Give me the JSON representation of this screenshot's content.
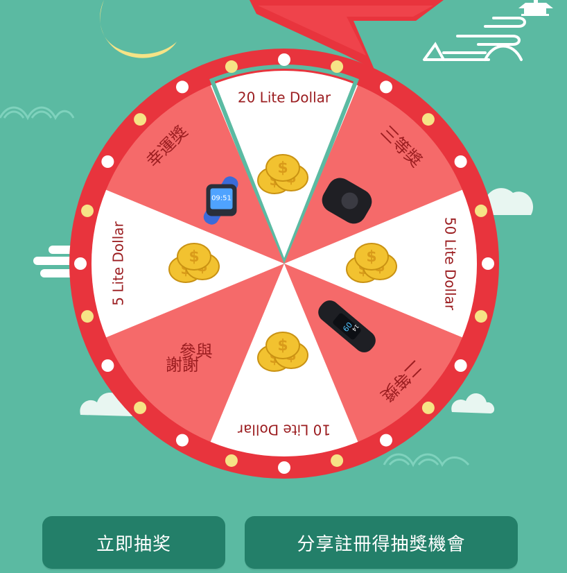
{
  "colors": {
    "background": "#5bbaa2",
    "rim": "#e8343d",
    "segment_pink": "#f56a6a",
    "segment_white": "#ffffff",
    "text_dark_red": "#9b1d20",
    "moon": "#f6e386",
    "button": "#237f69"
  },
  "wheel": {
    "segments": [
      {
        "label": "20 Lite Dollar",
        "prize_icon": "gold-coins-icon",
        "fill": "white",
        "highlighted": true
      },
      {
        "label": "三等獎",
        "prize_icon": "wireless-earbuds-case-icon",
        "fill": "pink"
      },
      {
        "label": "50 Lite Dollar",
        "prize_icon": "gold-coins-icon",
        "fill": "white"
      },
      {
        "label": "二等獎",
        "prize_icon": "fitness-band-icon",
        "fill": "pink"
      },
      {
        "label": "10 Lite Dollar",
        "prize_icon": "gold-coins-icon",
        "fill": "white"
      },
      {
        "label": "謝謝參與",
        "line1": "謝謝",
        "line2": "參與",
        "prize_icon": "",
        "fill": "pink"
      },
      {
        "label": "5 Lite Dollar",
        "prize_icon": "gold-coins-icon",
        "fill": "white"
      },
      {
        "label": "幸運獎",
        "prize_icon": "kids-smartwatch-icon",
        "fill": "pink"
      }
    ],
    "watch_time": "09:51",
    "band_time": "09",
    "band_sub": "14"
  },
  "buttons": {
    "spin_label": "立即抽奖",
    "share_label": "分享註冊得抽獎機會"
  },
  "decor": {
    "pointer_icon": "lightning-pointer-icon",
    "moon_icon": "crescent-moon-icon",
    "cloud_icon": "cloud-icon",
    "pavilion_icon": "pavilion-icon"
  }
}
